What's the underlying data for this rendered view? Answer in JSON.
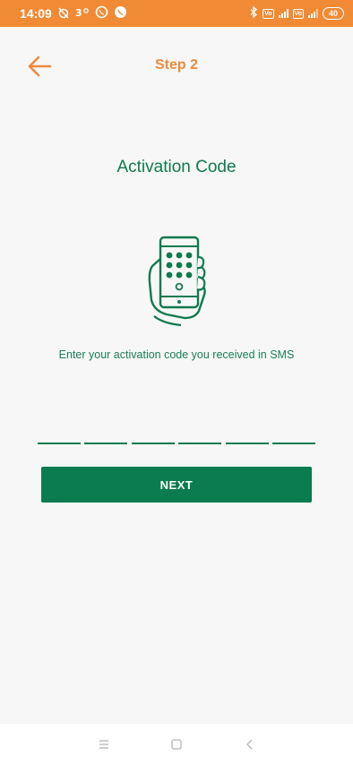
{
  "status_bar": {
    "time": "14:09",
    "battery": "40"
  },
  "header": {
    "title": "Step 2"
  },
  "main": {
    "title": "Activation Code",
    "instruction": "Enter your activation code you received in SMS",
    "code_boxes": [
      "",
      "",
      "",
      "",
      "",
      ""
    ],
    "next_label": "NEXT"
  },
  "colors": {
    "accent_orange": "#f08a34",
    "brand_green": "#0b7b50",
    "background": "#f7f7f7"
  },
  "icons": {
    "back": "arrow-left-icon",
    "illustration": "phone-keypad-hand-icon",
    "nav_menu": "menu-icon",
    "nav_home": "home-square-icon",
    "nav_back": "chevron-left-icon"
  }
}
